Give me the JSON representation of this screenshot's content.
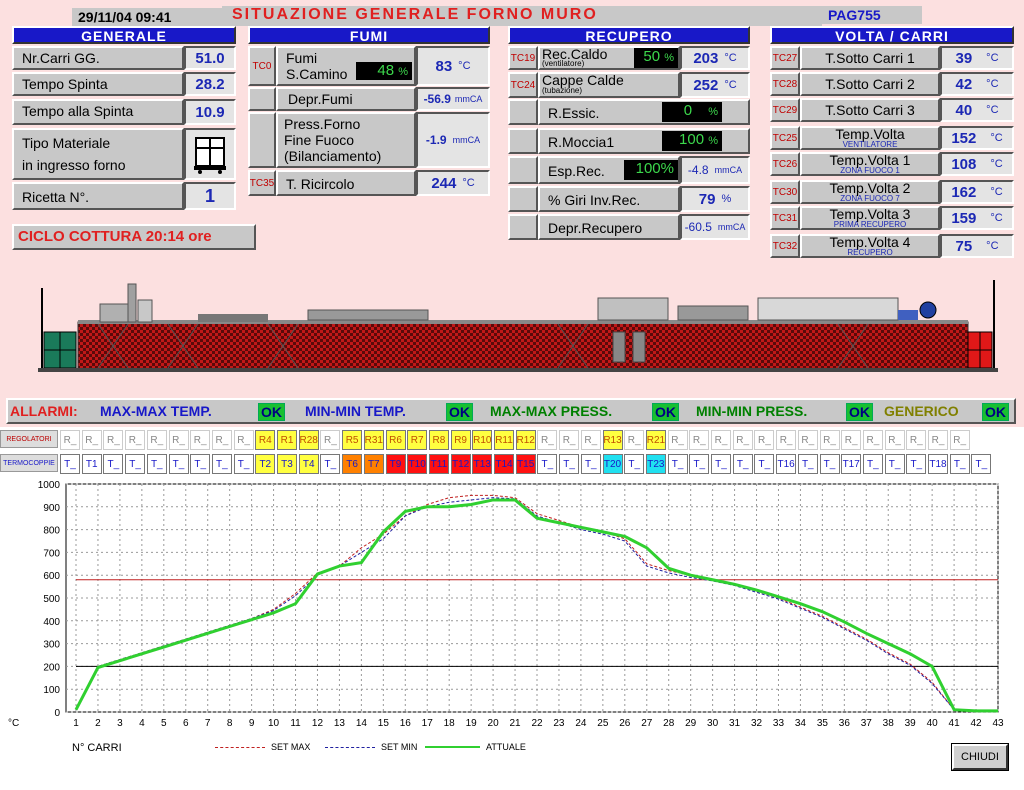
{
  "header": {
    "datetime": "29/11/04   09:41",
    "title": "SITUAZIONE GENERALE FORNO MURO",
    "page": "PAG755"
  },
  "generale": {
    "title": "GENERALE",
    "rows": [
      {
        "label": "Nr.Carri GG.",
        "value": "51.0"
      },
      {
        "label": "Tempo Spinta",
        "value": "28.2"
      },
      {
        "label": "Tempo alla Spinta",
        "value": "10.9"
      },
      {
        "label1": "Tipo Materiale",
        "label2": "in ingresso forno"
      },
      {
        "label": "Ricetta N°.",
        "value": "1"
      }
    ],
    "ciclo": "CICLO COTTURA 20:14 ore"
  },
  "fumi": {
    "title": "FUMI",
    "fumi_tag": "TC0",
    "fumi_label1": "Fumi",
    "fumi_label2": "S.Camino",
    "fumi_pct": "48",
    "pct_unit": "%",
    "fumi_val": "83",
    "degc": "°C",
    "depr_label": "Depr.Fumi",
    "depr_val": "-56.9",
    "mmca": "mmCA",
    "press_label1": "Press.Forno",
    "press_label2": "Fine Fuoco",
    "press_label3": "(Bilanciamento)",
    "press_val": "-1.9",
    "ricircolo_tag": "TC35",
    "ricircolo_label": "T. Ricircolo",
    "ricircolo_val": "244"
  },
  "recupero": {
    "title": "RECUPERO",
    "rows": [
      {
        "tag": "TC19",
        "label": "Rec.Caldo",
        "sub": "(ventilatore)",
        "pct": "50",
        "value": "203",
        "unit": "°C"
      },
      {
        "tag": "TC24",
        "label": "Cappe Calde",
        "sub": "(tubazione)",
        "value": "252",
        "unit": "°C"
      },
      {
        "label": "R.Essic.",
        "pct": "0"
      },
      {
        "label": "R.Moccia1",
        "pct": "100"
      },
      {
        "label": "Esp.Rec.",
        "pct": "100%",
        "value": "-4.8",
        "unit": "mmCA"
      },
      {
        "label": "% Giri Inv.Rec.",
        "value": "79",
        "unit": "%"
      },
      {
        "label": "Depr.Recupero",
        "value": "-60.5",
        "unit": "mmCA"
      }
    ]
  },
  "volta": {
    "title": "VOLTA / CARRI",
    "rows": [
      {
        "tag": "TC27",
        "label": "T.Sotto Carri 1",
        "value": "39",
        "unit": "°C"
      },
      {
        "tag": "TC28",
        "label": "T.Sotto Carri 2",
        "value": "42",
        "unit": "°C"
      },
      {
        "tag": "TC29",
        "label": "T.Sotto Carri 3",
        "value": "40",
        "unit": "°C"
      },
      {
        "tag": "TC25",
        "label": "Temp.Volta",
        "sub": "VENTILATORE",
        "value": "152",
        "unit": "°C"
      },
      {
        "tag": "TC26",
        "label": "Temp.Volta 1",
        "sub": "ZONA FUOCO 1",
        "value": "108",
        "unit": "°C"
      },
      {
        "tag": "TC30",
        "label": "Temp.Volta 2",
        "sub": "ZONA FUOCO 7",
        "value": "162",
        "unit": "°C"
      },
      {
        "tag": "TC31",
        "label": "Temp.Volta 3",
        "sub": "PRIMA RECUPERO",
        "value": "159",
        "unit": "°C"
      },
      {
        "tag": "TC32",
        "label": "Temp.Volta 4",
        "sub": "RECUPERO",
        "value": "75",
        "unit": "°C"
      }
    ]
  },
  "allarmi": {
    "title": "ALLARMI:",
    "items": [
      {
        "label": "MAX-MAX TEMP.",
        "status": "OK",
        "color": "#1818c8"
      },
      {
        "label": "MIN-MIN TEMP.",
        "status": "OK",
        "color": "#1818c8"
      },
      {
        "label": "MAX-MAX PRESS.",
        "status": "OK",
        "color": "#008000"
      },
      {
        "label": "MIN-MIN PRESS.",
        "status": "OK",
        "color": "#008000"
      },
      {
        "label": "GENERICO",
        "status": "OK",
        "color": "#808000"
      }
    ]
  },
  "regolatori": {
    "tag": "REGOLATORI",
    "cells": [
      "R_",
      "R_",
      "R_",
      "R_",
      "R_",
      "R_",
      "R_",
      "R_",
      "R_",
      "R4",
      "R1",
      "R28",
      "R_",
      "R5",
      "R31",
      "R6",
      "R7",
      "R8",
      "R9",
      "R10",
      "R11",
      "R12",
      "R_",
      "R_",
      "R_",
      "R13",
      "R_",
      "R21",
      "R_",
      "R_",
      "R_",
      "R_",
      "R_",
      "R_",
      "R_",
      "R_",
      "R_",
      "R_",
      "R_",
      "R_",
      "R_",
      "R_"
    ]
  },
  "termocoppie": {
    "tag": "TERMOCOPPIE",
    "cells": [
      "T_",
      "T1",
      "T_",
      "T_",
      "T_",
      "T_",
      "T_",
      "T_",
      "T_",
      "T2",
      "T3",
      "T4",
      "T_",
      "T6",
      "T7",
      "T9",
      "T10",
      "T11",
      "T12",
      "T13",
      "T14",
      "T15",
      "T_",
      "T_",
      "T_",
      "T20",
      "T_",
      "T23",
      "T_",
      "T_",
      "T_",
      "T_",
      "T_",
      "T16",
      "T_",
      "T_",
      "T17",
      "T_",
      "T_",
      "T_",
      "T18",
      "T_",
      "T_"
    ]
  },
  "chart_data": {
    "type": "line",
    "ylabel": "°C",
    "xlabel": "N° CARRI",
    "ylim": [
      0,
      1000
    ],
    "xlim": [
      1,
      43
    ],
    "x": [
      1,
      2,
      3,
      4,
      5,
      6,
      7,
      8,
      9,
      10,
      11,
      12,
      13,
      14,
      15,
      16,
      17,
      18,
      19,
      20,
      21,
      22,
      23,
      24,
      25,
      26,
      27,
      28,
      29,
      30,
      31,
      32,
      33,
      34,
      35,
      36,
      37,
      38,
      39,
      40,
      41,
      42,
      43
    ],
    "yticks": [
      0,
      100,
      200,
      300,
      400,
      500,
      600,
      700,
      800,
      900,
      1000
    ],
    "grid": true,
    "series": [
      {
        "name": "SET MAX",
        "color": "#c02020",
        "values": [
          10,
          200,
          230,
          260,
          290,
          320,
          350,
          380,
          410,
          450,
          520,
          610,
          640,
          720,
          780,
          860,
          910,
          940,
          950,
          950,
          940,
          870,
          840,
          810,
          790,
          760,
          650,
          620,
          600,
          580,
          560,
          530,
          500,
          460,
          420,
          370,
          320,
          260,
          210,
          130,
          10
        ]
      },
      {
        "name": "SET MIN",
        "color": "#2020a0",
        "values": [
          10,
          200,
          230,
          260,
          290,
          320,
          350,
          380,
          410,
          445,
          510,
          600,
          640,
          700,
          760,
          860,
          900,
          920,
          930,
          940,
          935,
          860,
          830,
          800,
          780,
          750,
          640,
          610,
          590,
          575,
          555,
          525,
          495,
          455,
          415,
          365,
          315,
          255,
          205,
          125,
          10
        ]
      },
      {
        "name": "ATTUALE",
        "color": "#30d030",
        "values": [
          10,
          195,
          225,
          255,
          285,
          315,
          345,
          375,
          405,
          435,
          475,
          605,
          640,
          655,
          790,
          880,
          900,
          900,
          910,
          930,
          930,
          850,
          830,
          810,
          790,
          770,
          720,
          630,
          600,
          580,
          560,
          535,
          505,
          475,
          440,
          395,
          345,
          300,
          255,
          200,
          10,
          5,
          5
        ]
      }
    ],
    "hlines": [
      {
        "value": 580,
        "color": "#c02020"
      },
      {
        "value": 200,
        "color": "#000000"
      }
    ]
  },
  "legend": {
    "xlabel": "N° CARRI",
    "s1": "SET MAX",
    "s2": "SET MIN",
    "s3": "ATTUALE",
    "ylabel": "°C"
  },
  "chiudi": "CHIUDI"
}
